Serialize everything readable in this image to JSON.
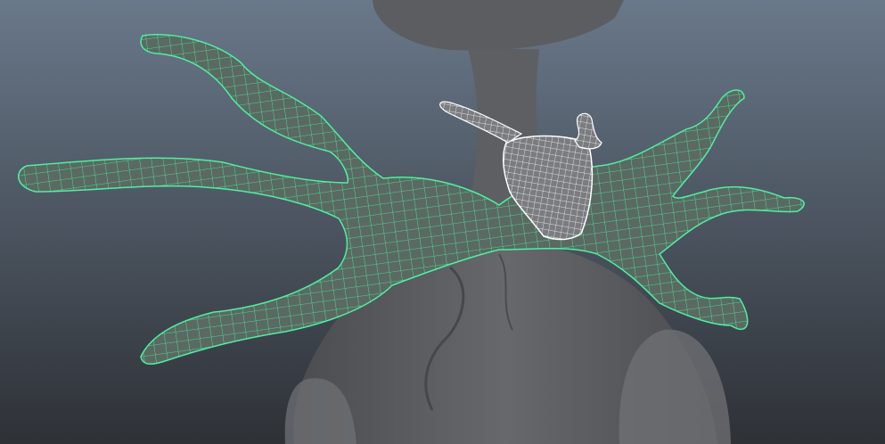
{
  "viewport": {
    "background_top": "#69788a",
    "background_bottom": "#2e3136",
    "body_color": "#5b5d61",
    "body_shadow": "#3f4145",
    "selected_wire_color": "#4ef0a2",
    "selected_fill_color": "#5a6a62",
    "object_wire_color": "#ffffff",
    "object_fill_color": "#7a7c80"
  },
  "objects": [
    {
      "name": "body-mesh",
      "state": "unselected"
    },
    {
      "name": "bow-tie-mesh",
      "state": "selected"
    },
    {
      "name": "bow-tie-knot-mesh",
      "state": "wireframe"
    }
  ]
}
